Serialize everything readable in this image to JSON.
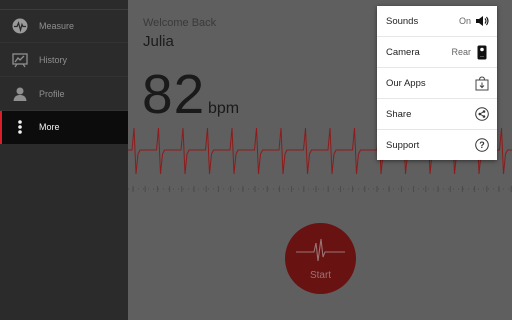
{
  "sidebar": {
    "items": [
      {
        "label": "Measure",
        "icon": "heartbeat-icon",
        "active": false
      },
      {
        "label": "History",
        "icon": "chart-icon",
        "active": false
      },
      {
        "label": "Profile",
        "icon": "person-icon",
        "active": false
      },
      {
        "label": "More",
        "icon": "more-vertical-icon",
        "active": true
      }
    ],
    "active_color": "#d81e2b"
  },
  "main": {
    "welcome": "Welcome Back",
    "username": "Julia",
    "bpm": "82",
    "bpm_unit": "bpm",
    "start_label": "Start",
    "ecg_color": "#8e1b1b"
  },
  "menu": {
    "items": [
      {
        "label": "Sounds",
        "value": "On",
        "icon": "speaker-icon"
      },
      {
        "label": "Camera",
        "value": "Rear",
        "icon": "phone-camera-icon"
      },
      {
        "label": "Our Apps",
        "value": "",
        "icon": "app-store-icon"
      },
      {
        "label": "Share",
        "value": "",
        "icon": "share-icon"
      },
      {
        "label": "Support",
        "value": "",
        "icon": "help-icon"
      }
    ]
  }
}
